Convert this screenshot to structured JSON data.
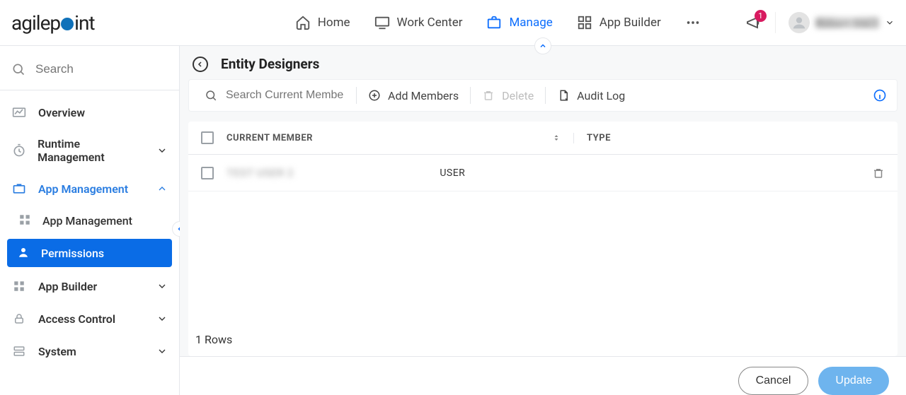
{
  "header": {
    "logo_prefix": "agilep",
    "logo_suffix": "int",
    "nav": {
      "home": "Home",
      "work_center": "Work Center",
      "manage": "Manage",
      "app_builder": "App Builder"
    },
    "notification_count": "1",
    "user_name": "Robert Ste..."
  },
  "sidebar": {
    "search_placeholder": "Search",
    "items": {
      "overview": "Overview",
      "runtime_management": "Runtime Management",
      "app_management": "App Management",
      "app_management_child": "App Management",
      "permissions": "Permissions",
      "app_builder": "App Builder",
      "access_control": "Access Control",
      "system": "System"
    }
  },
  "main": {
    "title": "Entity Designers",
    "toolbar": {
      "search_placeholder": "Search Current Members",
      "add_members": "Add Members",
      "delete": "Delete",
      "audit_log": "Audit Log"
    },
    "columns": {
      "member": "CURRENT MEMBER",
      "type": "TYPE"
    },
    "rows": [
      {
        "name": "TEST USER 2",
        "type": "USER"
      }
    ],
    "row_count_label": "1 Rows"
  },
  "footer": {
    "cancel": "Cancel",
    "update": "Update"
  }
}
